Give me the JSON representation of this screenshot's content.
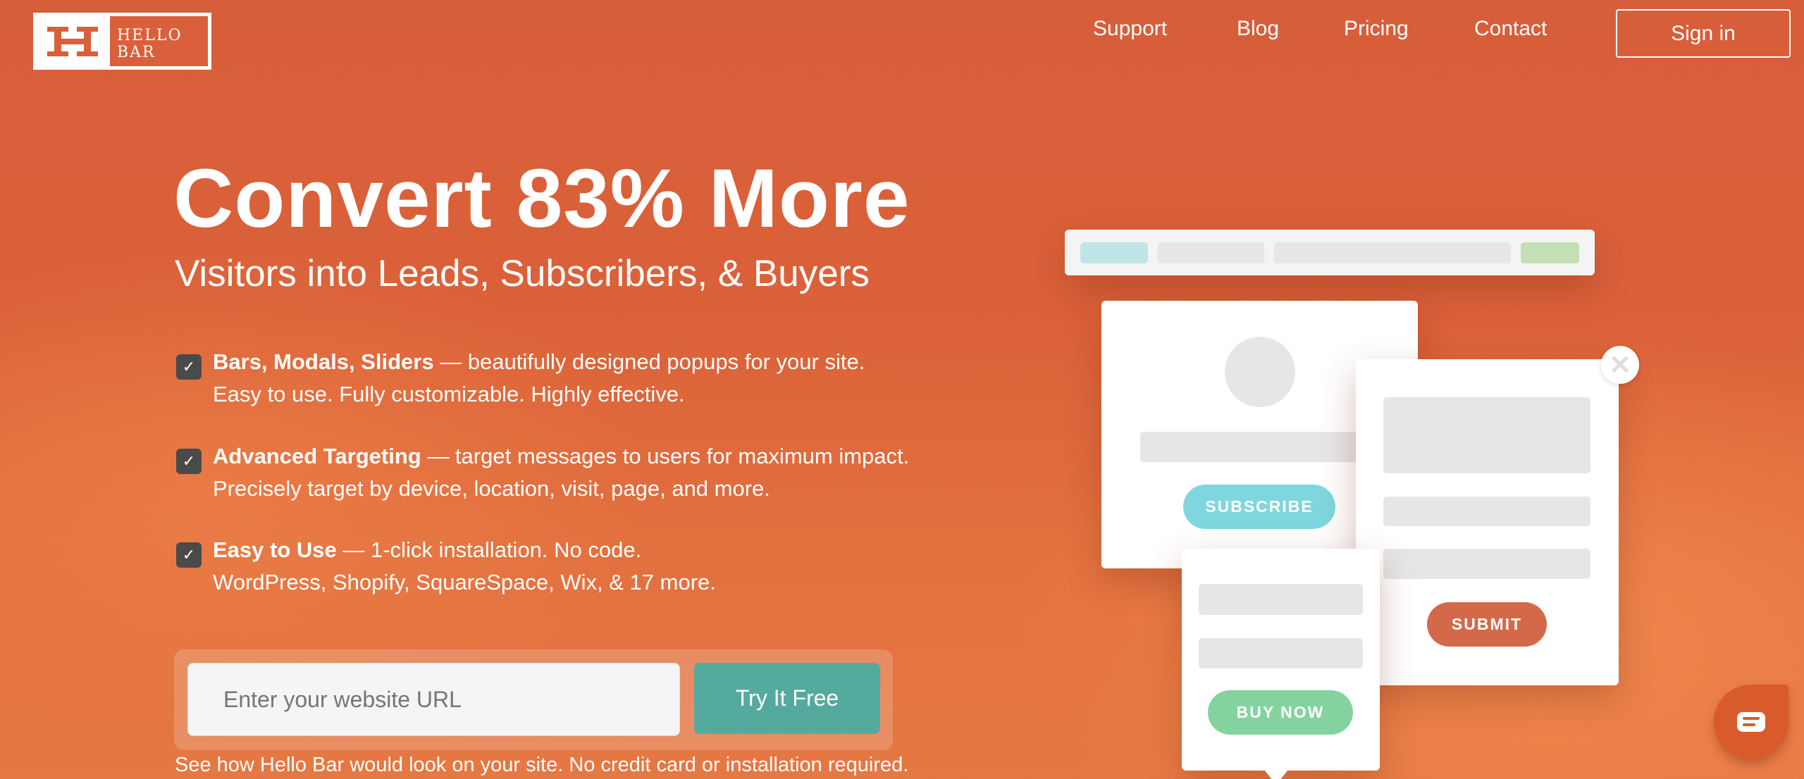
{
  "brand": {
    "logo_text_line1": "HELLO",
    "logo_text_line2": "BAR",
    "color": "#d9603a"
  },
  "nav": {
    "items": [
      "Support",
      "Blog",
      "Pricing",
      "Contact"
    ],
    "sign_in": "Sign in"
  },
  "hero": {
    "title": "Convert 83% More",
    "subtitle": "Visitors into Leads, Subscribers, & Buyers",
    "bullets": [
      {
        "bold": "Bars, Modals, Sliders",
        "rest": " — beautifully designed popups for your site.",
        "line2": "Easy to use. Fully customizable. Highly effective."
      },
      {
        "bold": "Advanced Targeting",
        "rest": " — target messages to users for maximum impact.",
        "line2": "Precisely target by device, location, visit, page, and more."
      },
      {
        "bold": "Easy to Use",
        "rest": " — 1-click installation. No code.",
        "line2": "WordPress, Shopify, SquareSpace, Wix, & 17 more."
      }
    ]
  },
  "form": {
    "placeholder": "Enter your website URL",
    "value": "",
    "button": "Try It Free",
    "caption": "See how Hello Bar would look on your site. No credit card or installation required."
  },
  "illustration": {
    "subscribe": "SUBSCRIBE",
    "submit": "SUBMIT",
    "buy_now": "BUY NOW",
    "colors": {
      "subscribe": "#80d6de",
      "submit": "#d4694a",
      "buy_now": "#84d39e"
    }
  },
  "chat": {
    "icon": "chat-bubble-icon"
  }
}
